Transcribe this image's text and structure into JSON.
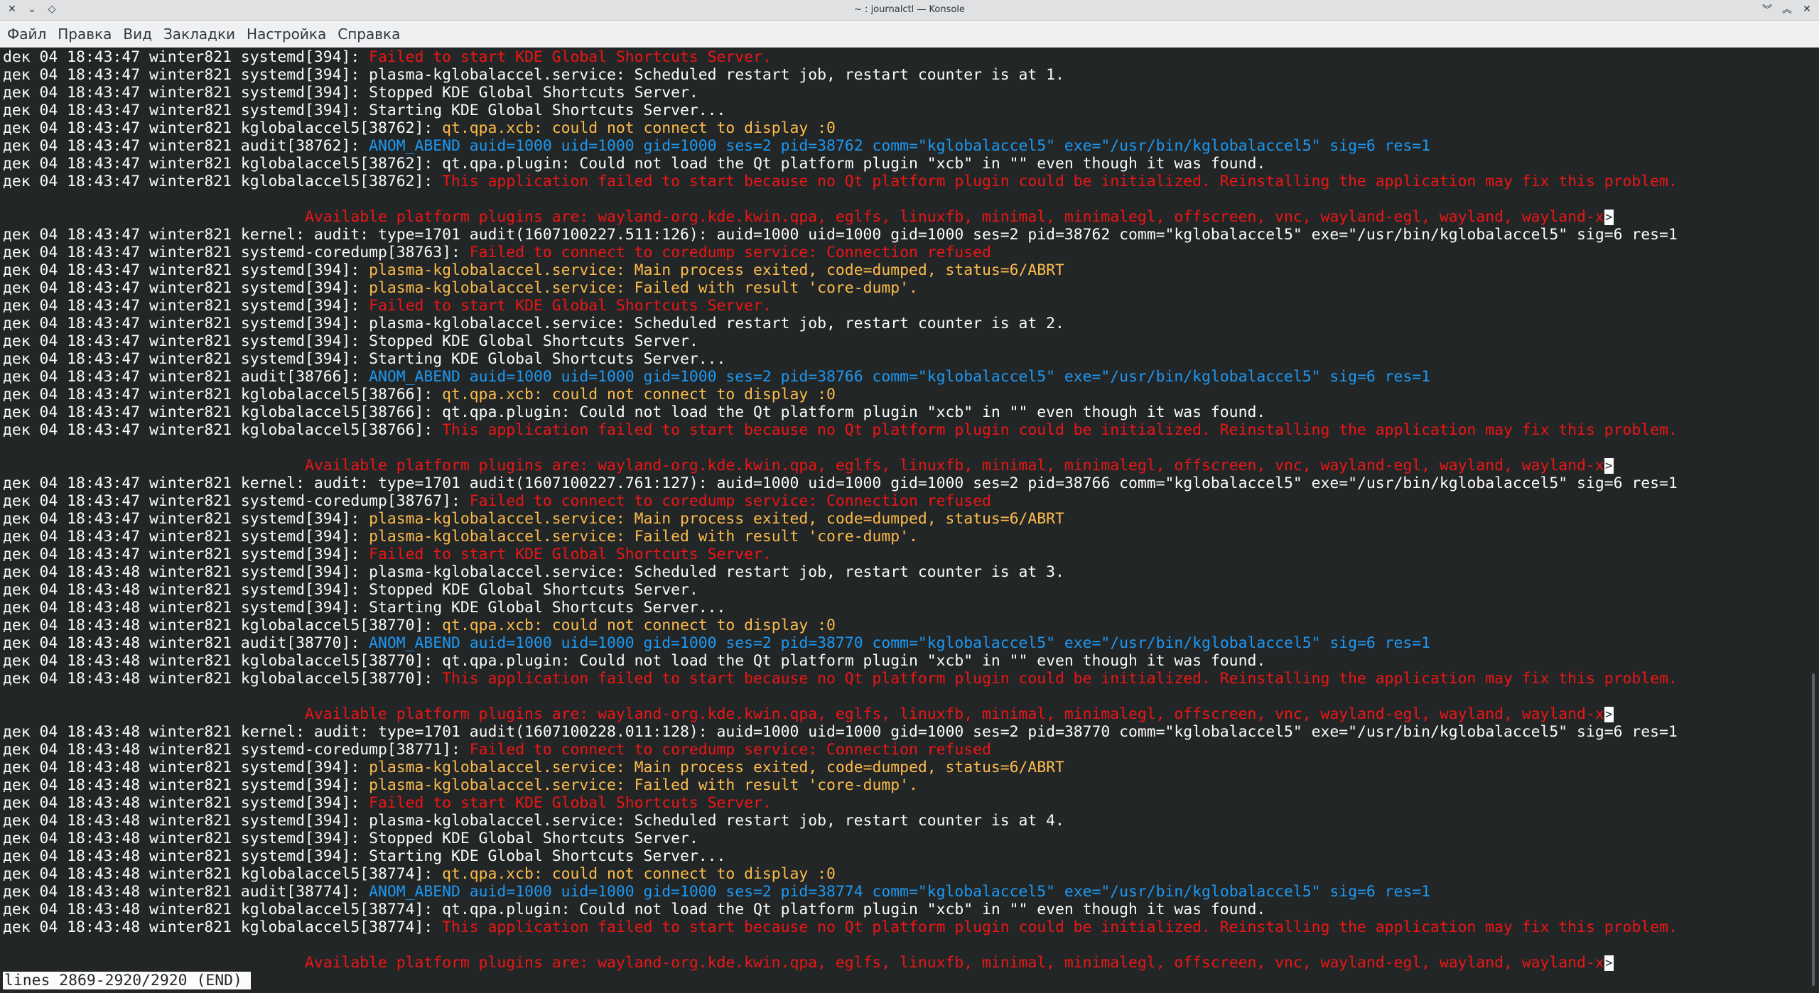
{
  "window": {
    "title": "~ : journalctl — Konsole"
  },
  "menu": [
    "Файл",
    "Правка",
    "Вид",
    "Закладки",
    "Настройка",
    "Справка"
  ],
  "lines": [
    [
      [
        "dек 04 18:43:47 winter821 systemd[394]: ",
        "plain"
      ],
      [
        "Failed to start KDE Global Shortcuts Server.",
        "red"
      ]
    ],
    [
      [
        "дек 04 18:43:47 winter821 systemd[394]: plasma-kglobalaccel.service: Scheduled restart job, restart counter is at 1.",
        "plain"
      ]
    ],
    [
      [
        "дек 04 18:43:47 winter821 systemd[394]: Stopped KDE Global Shortcuts Server.",
        "plain"
      ]
    ],
    [
      [
        "дек 04 18:43:47 winter821 systemd[394]: Starting KDE Global Shortcuts Server...",
        "plain"
      ]
    ],
    [
      [
        "дек 04 18:43:47 winter821 kglobalaccel5[38762]: ",
        "plain"
      ],
      [
        "qt.qpa.xcb: could not connect to display :0",
        "yellow"
      ]
    ],
    [
      [
        "дек 04 18:43:47 winter821 audit[38762]: ",
        "plain"
      ],
      [
        "ANOM_ABEND auid=1000 uid=1000 gid=1000 ses=2 pid=38762 comm=\"kglobalaccel5\" exe=\"/usr/bin/kglobalaccel5\" sig=6 res=1",
        "blue"
      ]
    ],
    [
      [
        "дек 04 18:43:47 winter821 kglobalaccel5[38762]: qt.qpa.plugin: Could not load the Qt platform plugin \"xcb\" in \"\" even though it was found.",
        "plain"
      ]
    ],
    [
      [
        "дек 04 18:43:47 winter821 kglobalaccel5[38762]: ",
        "plain"
      ],
      [
        "This application failed to start because no Qt platform plugin could be initialized. Reinstalling the application may fix this problem.",
        "red"
      ]
    ],
    [
      [
        "",
        "plain"
      ]
    ],
    [
      [
        "                                 ",
        "plain"
      ],
      [
        "Available platform plugins are: wayland-org.kde.kwin.qpa, eglfs, linuxfb, minimal, minimalegl, offscreen, vnc, wayland-egl, wayland, wayland-x",
        "red"
      ],
      [
        ">",
        "trunc"
      ]
    ],
    [
      [
        "дек 04 18:43:47 winter821 kernel: audit: type=1701 audit(1607100227.511:126): auid=1000 uid=1000 gid=1000 ses=2 pid=38762 comm=\"kglobalaccel5\" exe=\"/usr/bin/kglobalaccel5\" sig=6 res=1",
        "plain"
      ]
    ],
    [
      [
        "дек 04 18:43:47 winter821 systemd-coredump[38763]: ",
        "plain"
      ],
      [
        "Failed to connect to coredump service: Connection refused",
        "red"
      ]
    ],
    [
      [
        "дек 04 18:43:47 winter821 systemd[394]: ",
        "plain"
      ],
      [
        "plasma-kglobalaccel.service: Main process exited, code=dumped, status=6/ABRT",
        "yellow"
      ]
    ],
    [
      [
        "дек 04 18:43:47 winter821 systemd[394]: ",
        "plain"
      ],
      [
        "plasma-kglobalaccel.service: Failed with result 'core-dump'.",
        "yellow"
      ]
    ],
    [
      [
        "дек 04 18:43:47 winter821 systemd[394]: ",
        "plain"
      ],
      [
        "Failed to start KDE Global Shortcuts Server.",
        "red"
      ]
    ],
    [
      [
        "дек 04 18:43:47 winter821 systemd[394]: plasma-kglobalaccel.service: Scheduled restart job, restart counter is at 2.",
        "plain"
      ]
    ],
    [
      [
        "дек 04 18:43:47 winter821 systemd[394]: Stopped KDE Global Shortcuts Server.",
        "plain"
      ]
    ],
    [
      [
        "дек 04 18:43:47 winter821 systemd[394]: Starting KDE Global Shortcuts Server...",
        "plain"
      ]
    ],
    [
      [
        "дек 04 18:43:47 winter821 audit[38766]: ",
        "plain"
      ],
      [
        "ANOM_ABEND auid=1000 uid=1000 gid=1000 ses=2 pid=38766 comm=\"kglobalaccel5\" exe=\"/usr/bin/kglobalaccel5\" sig=6 res=1",
        "blue"
      ]
    ],
    [
      [
        "дек 04 18:43:47 winter821 kglobalaccel5[38766]: ",
        "plain"
      ],
      [
        "qt.qpa.xcb: could not connect to display :0",
        "yellow"
      ]
    ],
    [
      [
        "дек 04 18:43:47 winter821 kglobalaccel5[38766]: qt.qpa.plugin: Could not load the Qt platform plugin \"xcb\" in \"\" even though it was found.",
        "plain"
      ]
    ],
    [
      [
        "дек 04 18:43:47 winter821 kglobalaccel5[38766]: ",
        "plain"
      ],
      [
        "This application failed to start because no Qt platform plugin could be initialized. Reinstalling the application may fix this problem.",
        "red"
      ]
    ],
    [
      [
        "",
        "plain"
      ]
    ],
    [
      [
        "                                 ",
        "plain"
      ],
      [
        "Available platform plugins are: wayland-org.kde.kwin.qpa, eglfs, linuxfb, minimal, minimalegl, offscreen, vnc, wayland-egl, wayland, wayland-x",
        "red"
      ],
      [
        ">",
        "trunc"
      ]
    ],
    [
      [
        "дек 04 18:43:47 winter821 kernel: audit: type=1701 audit(1607100227.761:127): auid=1000 uid=1000 gid=1000 ses=2 pid=38766 comm=\"kglobalaccel5\" exe=\"/usr/bin/kglobalaccel5\" sig=6 res=1",
        "plain"
      ]
    ],
    [
      [
        "дек 04 18:43:47 winter821 systemd-coredump[38767]: ",
        "plain"
      ],
      [
        "Failed to connect to coredump service: Connection refused",
        "red"
      ]
    ],
    [
      [
        "дек 04 18:43:47 winter821 systemd[394]: ",
        "plain"
      ],
      [
        "plasma-kglobalaccel.service: Main process exited, code=dumped, status=6/ABRT",
        "yellow"
      ]
    ],
    [
      [
        "дек 04 18:43:47 winter821 systemd[394]: ",
        "plain"
      ],
      [
        "plasma-kglobalaccel.service: Failed with result 'core-dump'.",
        "yellow"
      ]
    ],
    [
      [
        "дек 04 18:43:47 winter821 systemd[394]: ",
        "plain"
      ],
      [
        "Failed to start KDE Global Shortcuts Server.",
        "red"
      ]
    ],
    [
      [
        "дек 04 18:43:48 winter821 systemd[394]: plasma-kglobalaccel.service: Scheduled restart job, restart counter is at 3.",
        "plain"
      ]
    ],
    [
      [
        "дек 04 18:43:48 winter821 systemd[394]: Stopped KDE Global Shortcuts Server.",
        "plain"
      ]
    ],
    [
      [
        "дек 04 18:43:48 winter821 systemd[394]: Starting KDE Global Shortcuts Server...",
        "plain"
      ]
    ],
    [
      [
        "дек 04 18:43:48 winter821 kglobalaccel5[38770]: ",
        "plain"
      ],
      [
        "qt.qpa.xcb: could not connect to display :0",
        "yellow"
      ]
    ],
    [
      [
        "дек 04 18:43:48 winter821 audit[38770]: ",
        "plain"
      ],
      [
        "ANOM_ABEND auid=1000 uid=1000 gid=1000 ses=2 pid=38770 comm=\"kglobalaccel5\" exe=\"/usr/bin/kglobalaccel5\" sig=6 res=1",
        "blue"
      ]
    ],
    [
      [
        "дек 04 18:43:48 winter821 kglobalaccel5[38770]: qt.qpa.plugin: Could not load the Qt platform plugin \"xcb\" in \"\" even though it was found.",
        "plain"
      ]
    ],
    [
      [
        "дек 04 18:43:48 winter821 kglobalaccel5[38770]: ",
        "plain"
      ],
      [
        "This application failed to start because no Qt platform plugin could be initialized. Reinstalling the application may fix this problem.",
        "red"
      ]
    ],
    [
      [
        "",
        "plain"
      ]
    ],
    [
      [
        "                                 ",
        "plain"
      ],
      [
        "Available platform plugins are: wayland-org.kde.kwin.qpa, eglfs, linuxfb, minimal, minimalegl, offscreen, vnc, wayland-egl, wayland, wayland-x",
        "red"
      ],
      [
        ">",
        "trunc"
      ]
    ],
    [
      [
        "дек 04 18:43:48 winter821 kernel: audit: type=1701 audit(1607100228.011:128): auid=1000 uid=1000 gid=1000 ses=2 pid=38770 comm=\"kglobalaccel5\" exe=\"/usr/bin/kglobalaccel5\" sig=6 res=1",
        "plain"
      ]
    ],
    [
      [
        "дек 04 18:43:48 winter821 systemd-coredump[38771]: ",
        "plain"
      ],
      [
        "Failed to connect to coredump service: Connection refused",
        "red"
      ]
    ],
    [
      [
        "дек 04 18:43:48 winter821 systemd[394]: ",
        "plain"
      ],
      [
        "plasma-kglobalaccel.service: Main process exited, code=dumped, status=6/ABRT",
        "yellow"
      ]
    ],
    [
      [
        "дек 04 18:43:48 winter821 systemd[394]: ",
        "plain"
      ],
      [
        "plasma-kglobalaccel.service: Failed with result 'core-dump'.",
        "yellow"
      ]
    ],
    [
      [
        "дек 04 18:43:48 winter821 systemd[394]: ",
        "plain"
      ],
      [
        "Failed to start KDE Global Shortcuts Server.",
        "red"
      ]
    ],
    [
      [
        "дек 04 18:43:48 winter821 systemd[394]: plasma-kglobalaccel.service: Scheduled restart job, restart counter is at 4.",
        "plain"
      ]
    ],
    [
      [
        "дек 04 18:43:48 winter821 systemd[394]: Stopped KDE Global Shortcuts Server.",
        "plain"
      ]
    ],
    [
      [
        "дек 04 18:43:48 winter821 systemd[394]: Starting KDE Global Shortcuts Server...",
        "plain"
      ]
    ],
    [
      [
        "дек 04 18:43:48 winter821 kglobalaccel5[38774]: ",
        "plain"
      ],
      [
        "qt.qpa.xcb: could not connect to display :0",
        "yellow"
      ]
    ],
    [
      [
        "дек 04 18:43:48 winter821 audit[38774]: ",
        "plain"
      ],
      [
        "ANOM_ABEND auid=1000 uid=1000 gid=1000 ses=2 pid=38774 comm=\"kglobalaccel5\" exe=\"/usr/bin/kglobalaccel5\" sig=6 res=1",
        "blue"
      ]
    ],
    [
      [
        "дек 04 18:43:48 winter821 kglobalaccel5[38774]: qt.qpa.plugin: Could not load the Qt platform plugin \"xcb\" in \"\" even though it was found.",
        "plain"
      ]
    ],
    [
      [
        "дек 04 18:43:48 winter821 kglobalaccel5[38774]: ",
        "plain"
      ],
      [
        "This application failed to start because no Qt platform plugin could be initialized. Reinstalling the application may fix this problem.",
        "red"
      ]
    ],
    [
      [
        "",
        "plain"
      ]
    ],
    [
      [
        "                                 ",
        "plain"
      ],
      [
        "Available platform plugins are: wayland-org.kde.kwin.qpa, eglfs, linuxfb, minimal, minimalegl, offscreen, vnc, wayland-egl, wayland, wayland-x",
        "red"
      ],
      [
        ">",
        "trunc"
      ]
    ]
  ],
  "pager_status": "lines 2869-2920/2920 (END)",
  "colors": {
    "background": "#232627",
    "text": "#fcfcfc",
    "error": "#ed1515",
    "warning": "#fdbc4b",
    "audit": "#1d99f3"
  }
}
